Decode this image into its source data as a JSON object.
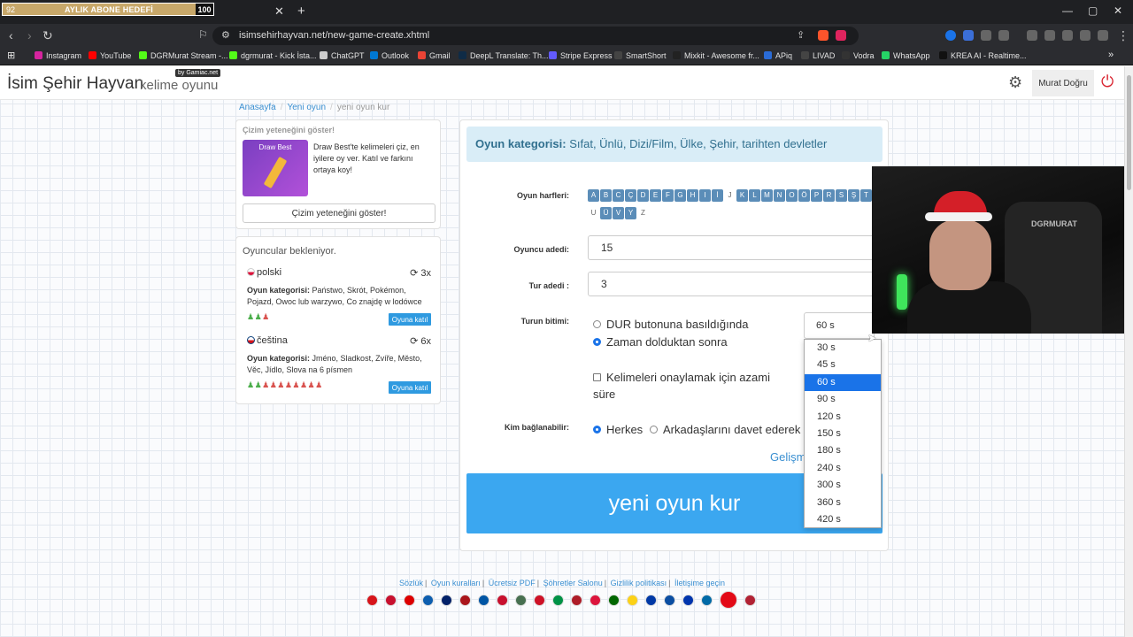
{
  "overlay": {
    "left_num": "92",
    "label": "AYLIK ABONE HEDEFİ",
    "right_num": "100"
  },
  "browser": {
    "url": "isimsehirhayvan.net/new-game-create.xhtml",
    "bookmarks": [
      {
        "label": "Instagram",
        "color": "#d6249f"
      },
      {
        "label": "YouTube",
        "color": "#ff0000"
      },
      {
        "label": "DGRMurat Stream -...",
        "color": "#53fc18"
      },
      {
        "label": "dgrmurat - Kick İsta...",
        "color": "#53fc18"
      },
      {
        "label": "ChatGPT",
        "color": "#cccccc"
      },
      {
        "label": "Outlook",
        "color": "#0078d4"
      },
      {
        "label": "Gmail",
        "color": "#ea4335"
      },
      {
        "label": "DeepL Translate: Th...",
        "color": "#0f2b46"
      },
      {
        "label": "Stripe Express",
        "color": "#635bff"
      },
      {
        "label": "SmartShort",
        "color": "#444444"
      },
      {
        "label": "Mixkit - Awesome fr...",
        "color": "#222222"
      },
      {
        "label": "APiq",
        "color": "#2a6bd6"
      },
      {
        "label": "LIVAD",
        "color": "#444444"
      },
      {
        "label": "Vodra",
        "color": "#333333"
      },
      {
        "label": "WhatsApp",
        "color": "#25d366"
      },
      {
        "label": "KREA AI - Realtime...",
        "color": "#111111"
      }
    ]
  },
  "header": {
    "logo_main": "İsim Şehir Hayvan",
    "logo_sub": "kelime oyunu",
    "logo_by": "by Gamiac.net",
    "user_name": "Murat Doğru"
  },
  "breadcrumb": {
    "home": "Anasayfa",
    "new_game": "Yeni oyun",
    "current": "yeni oyun kur"
  },
  "draw_card": {
    "title": "Çizim yeteneğini göster!",
    "image_text": "Draw Best",
    "text": "Draw Best'te kelimeleri çiz, en iyilere oy ver. Katıl ve farkını ortaya koy!",
    "button": "Çizim yeteneğini göster!"
  },
  "players": {
    "title": "Oyuncular bekleniyor.",
    "rooms": [
      {
        "lang": "polski",
        "count": "3x",
        "category_label": "Oyun kategorisi:",
        "category": "Państwo, Skrót, Pokémon, Pojazd, Owoc lub warzywo, Co znajdę w lodówce",
        "join": "Oyuna katıl",
        "people": "♟♟♟"
      },
      {
        "lang": "čeština",
        "count": "6x",
        "category_label": "Oyun kategorisi:",
        "category": "Jméno, Sladkost, Zvíře, Město, Věc, Jídlo, Slova na 6 písmen",
        "join": "Oyuna katıl",
        "people": "♟♟♟♟♟♟♟♟♟♟"
      }
    ]
  },
  "form": {
    "category_label": "Oyun kategorisi:",
    "category_value": "Sıfat, Ünlü, Dizi/Film, Ülke, Şehir, tarihten devletler",
    "letters_label": "Oyun harfleri:",
    "letters": [
      {
        "l": "A",
        "on": true
      },
      {
        "l": "B",
        "on": true
      },
      {
        "l": "C",
        "on": true
      },
      {
        "l": "Ç",
        "on": true
      },
      {
        "l": "D",
        "on": true
      },
      {
        "l": "E",
        "on": true
      },
      {
        "l": "F",
        "on": true
      },
      {
        "l": "G",
        "on": true
      },
      {
        "l": "H",
        "on": true
      },
      {
        "l": "I",
        "on": true
      },
      {
        "l": "İ",
        "on": true
      },
      {
        "l": "J",
        "on": false
      },
      {
        "l": "K",
        "on": true
      },
      {
        "l": "L",
        "on": true
      },
      {
        "l": "M",
        "on": true
      },
      {
        "l": "N",
        "on": true
      },
      {
        "l": "O",
        "on": true
      },
      {
        "l": "Ö",
        "on": true
      },
      {
        "l": "P",
        "on": true
      },
      {
        "l": "R",
        "on": true
      },
      {
        "l": "S",
        "on": true
      },
      {
        "l": "Ş",
        "on": true
      },
      {
        "l": "T",
        "on": true
      },
      {
        "l": "U",
        "on": false
      },
      {
        "l": "Ü",
        "on": true
      },
      {
        "l": "V",
        "on": true
      },
      {
        "l": "Y",
        "on": true
      },
      {
        "l": "Z",
        "on": false
      }
    ],
    "players_label": "Oyuncu adedi:",
    "players_value": "15",
    "rounds_label": "Tur adedi :",
    "rounds_value": "3",
    "round_end_label": "Turun bitimi:",
    "round_end_opt1": "DUR butonuna basıldığında",
    "round_end_opt2": "Zaman dolduktan sonra",
    "confirm_checkbox": "Kelimeleri onaylamak için azami süre",
    "who_label": "Kim bağlanabilir:",
    "who_opt1": "Herkes",
    "who_opt2": "Arkadaşlarını davet ederek",
    "advanced_link": "Gelişm",
    "create_button": "yeni oyun kur"
  },
  "time_select": {
    "value": "60 s",
    "options": [
      "30 s",
      "45 s",
      "60 s",
      "90 s",
      "120 s",
      "150 s",
      "180 s",
      "240 s",
      "300 s",
      "360 s",
      "420 s"
    ],
    "selected_index": 2
  },
  "webcam": {
    "chair_text": "DGRMURAT"
  },
  "footer": {
    "links": [
      "Sözlük",
      "Oyun kuralları",
      "Ücretsiz PDF",
      "Şöhretler Salonu",
      "Gizlilik politikası",
      "İletişime geçin"
    ],
    "flag_colors": [
      "#d7141a",
      "#c8102e",
      "#dd0000",
      "#0d5eaf",
      "#012169",
      "#aa151b",
      "#0055a4",
      "#c8102e",
      "#477050",
      "#ce1126",
      "#009246",
      "#ae1c28",
      "#dc143c",
      "#006600",
      "#fcd116",
      "#0039a6",
      "#0b4ea2",
      "#0035ad",
      "#006aa7",
      "#e30a17",
      "#b22234"
    ]
  }
}
